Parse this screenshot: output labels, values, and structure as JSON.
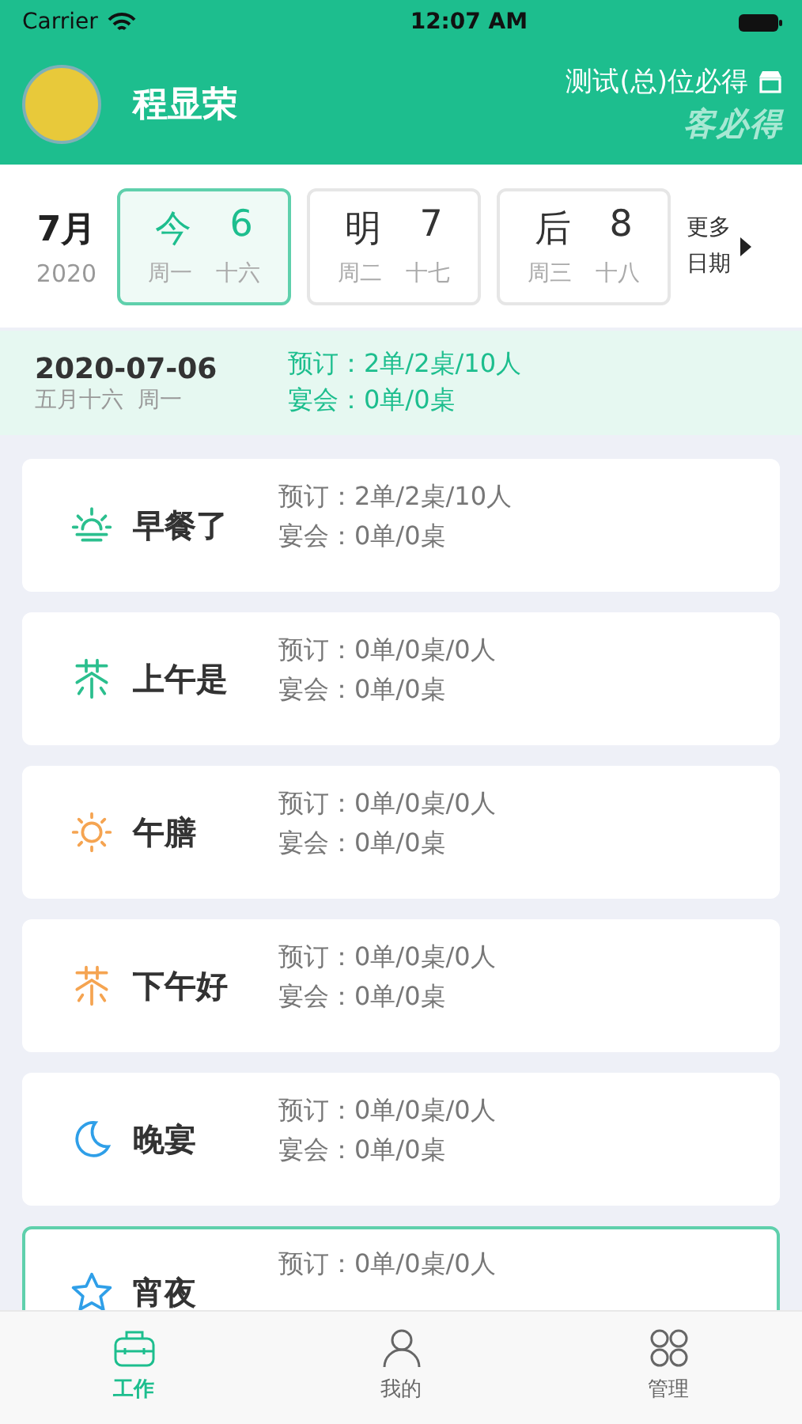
{
  "status_bar": {
    "carrier": "Carrier",
    "time": "12:07 AM"
  },
  "header": {
    "user_name": "程显荣",
    "store_name": "测试(总)位必得",
    "logo_text": "客必得"
  },
  "date_strip": {
    "month": "7月",
    "year": "2020",
    "days": [
      {
        "label": "今",
        "day": "6",
        "weekday": "周一",
        "lunar": "十六",
        "selected": true
      },
      {
        "label": "明",
        "day": "7",
        "weekday": "周二",
        "lunar": "十七",
        "selected": false
      },
      {
        "label": "后",
        "day": "8",
        "weekday": "周三",
        "lunar": "十八",
        "selected": false
      }
    ],
    "more": [
      "更多",
      "日期"
    ]
  },
  "summary": {
    "date": "2020-07-06",
    "lunar_weekday": "五月十六  周一",
    "booking": "预订：2单/2桌/10人",
    "banquet": "宴会：0单/0桌"
  },
  "meals": [
    {
      "kind": "sunrise",
      "color": "#2bbf8e",
      "name": "早餐了",
      "booking": "预订：2单/2桌/10人",
      "banquet": "宴会：0单/0桌",
      "selected": false
    },
    {
      "kind": "tea",
      "color": "#2bbf8e",
      "name": "上午是",
      "booking": "预订：0单/0桌/0人",
      "banquet": "宴会：0单/0桌",
      "selected": false
    },
    {
      "kind": "sun",
      "color": "#f5a451",
      "name": "午膳",
      "booking": "预订：0单/0桌/0人",
      "banquet": "宴会：0单/0桌",
      "selected": false
    },
    {
      "kind": "tea",
      "color": "#f5a451",
      "name": "下午好",
      "booking": "预订：0单/0桌/0人",
      "banquet": "宴会：0单/0桌",
      "selected": false
    },
    {
      "kind": "moon",
      "color": "#2f9fe8",
      "name": "晚宴",
      "booking": "预订：0单/0桌/0人",
      "banquet": "宴会：0单/0桌",
      "selected": false
    },
    {
      "kind": "star",
      "color": "#2f9fe8",
      "name": "宵夜",
      "booking": "预订：0单/0桌/0人",
      "selected": true
    }
  ],
  "tab_bar": [
    {
      "kind": "work",
      "label": "工作",
      "selected": true
    },
    {
      "kind": "person",
      "label": "我的",
      "selected": false
    },
    {
      "kind": "grid",
      "label": "管理",
      "selected": false
    }
  ]
}
